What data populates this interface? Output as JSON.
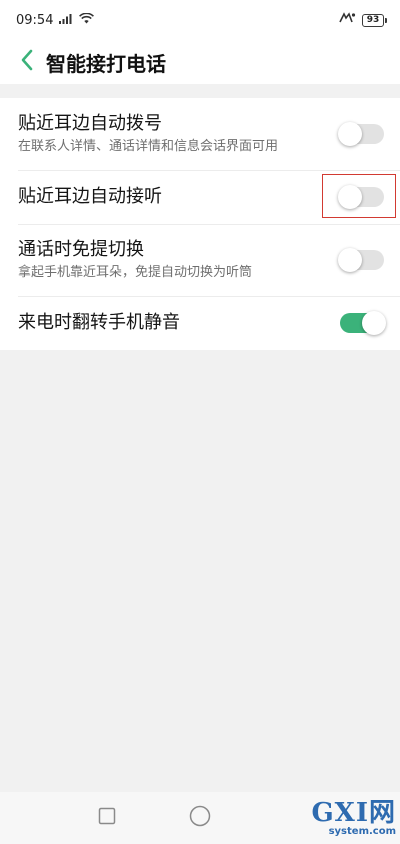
{
  "status_bar": {
    "time": "09:54",
    "signal_icon": "signal-icon",
    "wifi_icon": "wifi-icon",
    "hd_call_icon": "hd-call-icon",
    "battery_level": "93"
  },
  "header": {
    "back_icon": "chevron-left-icon",
    "title": "智能接打电话"
  },
  "settings": [
    {
      "title": "贴近耳边自动拨号",
      "subtitle": "在联系人详情、通话详情和信息会话界面可用",
      "enabled": false
    },
    {
      "title": "贴近耳边自动接听",
      "subtitle": "",
      "enabled": false
    },
    {
      "title": "通话时免提切换",
      "subtitle": "拿起手机靠近耳朵，免提自动切换为听筒",
      "enabled": false
    },
    {
      "title": "来电时翻转手机静音",
      "subtitle": "",
      "enabled": true
    }
  ],
  "nav_bar": {
    "recent_icon": "square-icon",
    "home_icon": "circle-icon"
  },
  "watermark": {
    "main": "GXI网",
    "sub": "system.com"
  },
  "colors": {
    "accent": "#3bb27a",
    "toggle_off": "#e2e2e2",
    "highlight": "#d23a32",
    "background": "#f1f1f1"
  }
}
